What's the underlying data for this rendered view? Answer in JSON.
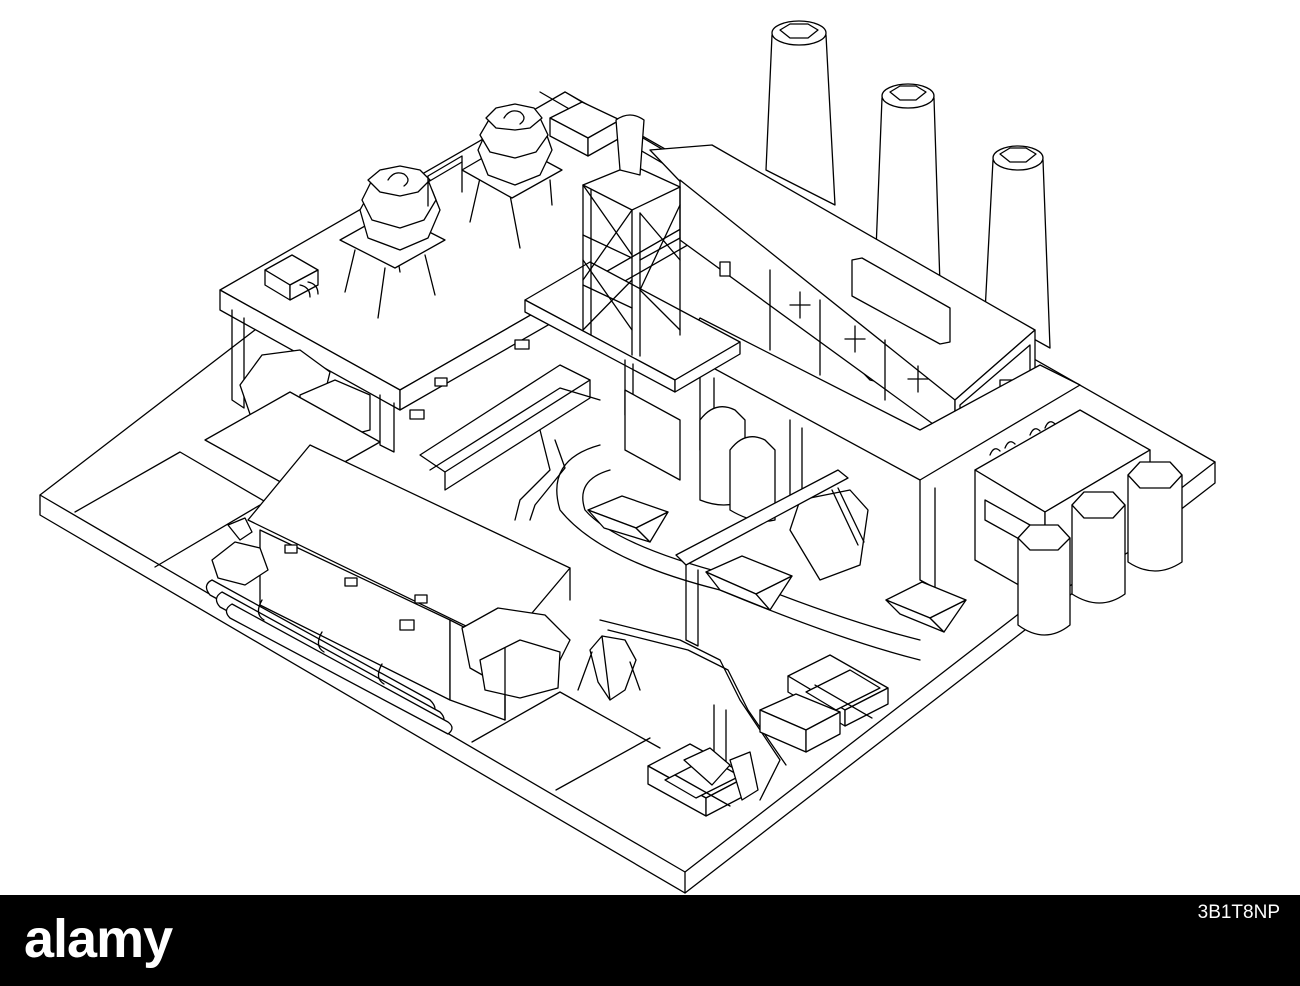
{
  "illustration": {
    "subject": "isometric-factory-outline",
    "line_color": "#000000",
    "background_color": "#ffffff"
  },
  "footer": {
    "brand": "alamy",
    "image_id": "3B1T8NP",
    "background_color": "#000000",
    "text_color": "#ffffff"
  }
}
